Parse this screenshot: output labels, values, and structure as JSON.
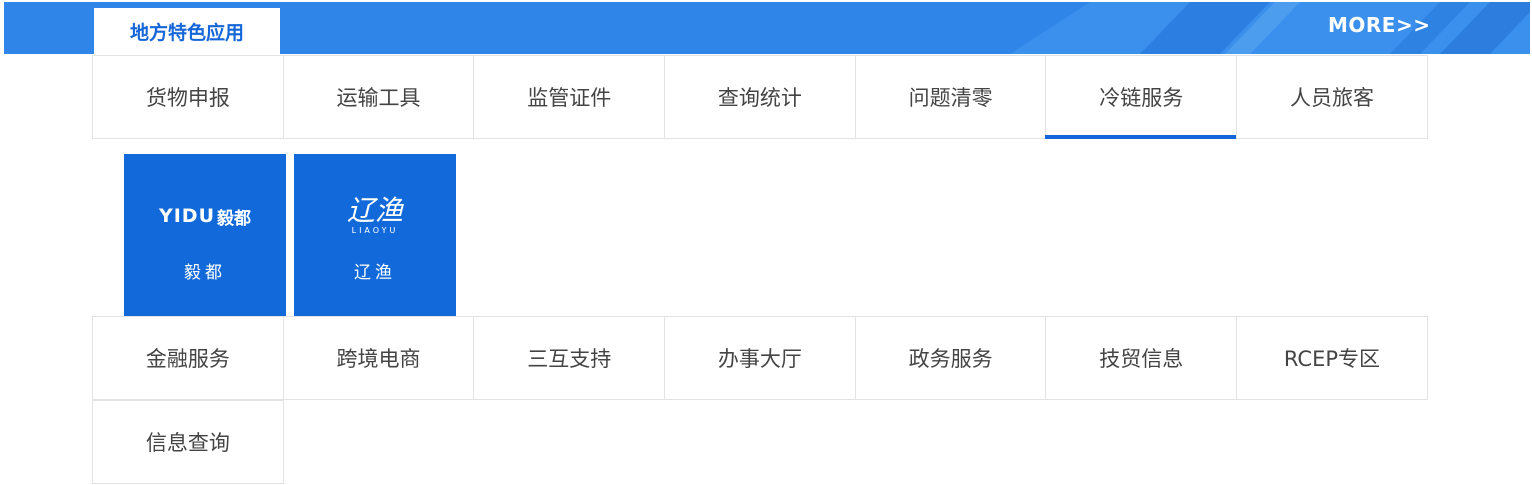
{
  "header": {
    "tab_label": "地方特色应用",
    "more_label": "MORE>>",
    "accent_color": "#2f86e8",
    "tab_text_color": "#1566d8"
  },
  "categories_row1": [
    {
      "label": "货物申报",
      "active": false
    },
    {
      "label": "运输工具",
      "active": false
    },
    {
      "label": "监管证件",
      "active": false
    },
    {
      "label": "查询统计",
      "active": false
    },
    {
      "label": "问题清零",
      "active": false
    },
    {
      "label": "冷链服务",
      "active": true
    },
    {
      "label": "人员旅客",
      "active": false
    }
  ],
  "apps": [
    {
      "logo_latin": "YIDU",
      "logo_cn": "毅都",
      "name": "毅都"
    },
    {
      "logo_cn": "辽渔",
      "logo_latin": "LIAOYU",
      "name": "辽渔"
    }
  ],
  "categories_row2": [
    {
      "label": "金融服务"
    },
    {
      "label": "跨境电商"
    },
    {
      "label": "三互支持"
    },
    {
      "label": "办事大厅"
    },
    {
      "label": "政务服务"
    },
    {
      "label": "技贸信息"
    },
    {
      "label": "RCEP专区"
    }
  ],
  "categories_row3": [
    {
      "label": "信息查询"
    }
  ],
  "colors": {
    "active_underline": "#1566d8",
    "tile_bg": "#1169da",
    "cell_border": "#e3e3e3"
  }
}
